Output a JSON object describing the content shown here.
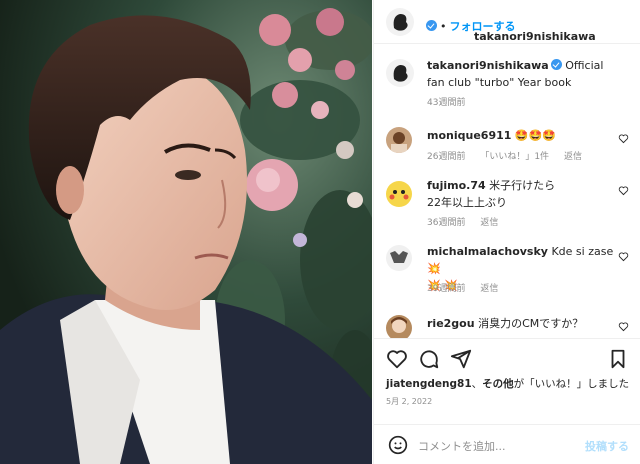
{
  "post": {
    "image_alt": "Portrait photo in front of flowers"
  },
  "header": {
    "username": "takanori9nishikawa",
    "follow_label": "フォローする",
    "separator": "•"
  },
  "caption": {
    "username": "takanori9nishikawa",
    "text": "Official fan club \"turbo\" Year book",
    "time": "43週間前"
  },
  "comments": [
    {
      "username": "monique6911",
      "text": "🤩🤩🤩",
      "time": "26週間前",
      "likes": "「いいね！」1件",
      "reply": "返信"
    },
    {
      "username": "fujimo.74",
      "text": "米子行けたら\n22年以上上ぶり",
      "time": "36週間前",
      "reply": "返信"
    },
    {
      "username": "michalmalachovsky",
      "text": "Kde si zase 💥\n💥 💥",
      "time": "39週間前",
      "reply": "返信"
    },
    {
      "username": "rie2gou",
      "text": "消臭力のCMですか？",
      "time": "",
      "reply": ""
    }
  ],
  "actions": {
    "like_icon": "heart-icon",
    "comment_icon": "comment-icon",
    "share_icon": "send-icon",
    "save_icon": "bookmark-icon"
  },
  "likes": {
    "user": "jiatengdeng81",
    "connector": "、",
    "others": "その他",
    "suffix": "が「いいね！」しました"
  },
  "date": "5月 2, 2022",
  "composer": {
    "placeholder": "コメントを追加...",
    "post_label": "投稿する"
  },
  "colors": {
    "accent": "#0095f6",
    "verified": "#3897f0",
    "muted": "#8e8e8e"
  }
}
